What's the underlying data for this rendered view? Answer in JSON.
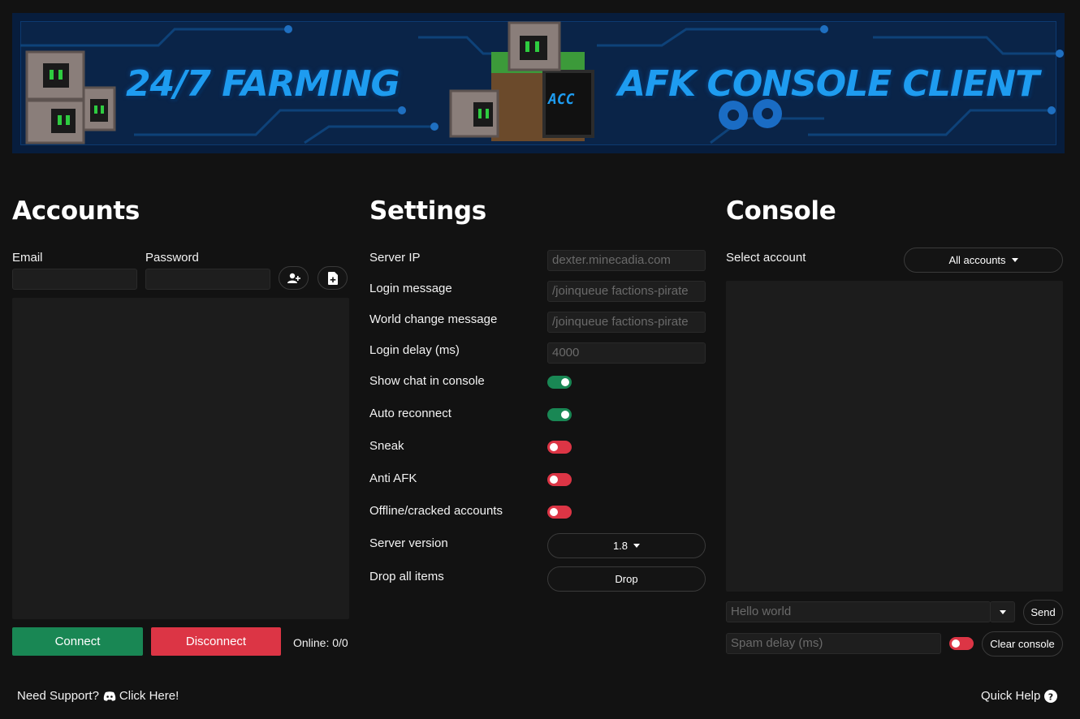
{
  "banner": {
    "left_text": "24/7 FARMING",
    "right_text": "AFK CONSOLE CLIENT",
    "logo_text": "ACC"
  },
  "accounts": {
    "title": "Accounts",
    "email_label": "Email",
    "password_label": "Password",
    "email_value": "",
    "password_value": "",
    "add_account_icon": "user-plus-icon",
    "import_file_icon": "file-plus-icon",
    "connect_label": "Connect",
    "disconnect_label": "Disconnect",
    "online_text": "Online: 0/0"
  },
  "settings": {
    "title": "Settings",
    "server_ip_label": "Server IP",
    "server_ip_placeholder": "dexter.minecadia.com",
    "login_message_label": "Login message",
    "login_message_placeholder": "/joinqueue factions-pirate",
    "world_change_label": "World change message",
    "world_change_placeholder": "/joinqueue factions-pirate",
    "login_delay_label": "Login delay (ms)",
    "login_delay_placeholder": "4000",
    "toggles": [
      {
        "label": "Show chat in console",
        "on": true
      },
      {
        "label": "Auto reconnect",
        "on": true
      },
      {
        "label": "Sneak",
        "on": false
      },
      {
        "label": "Anti AFK",
        "on": false
      },
      {
        "label": "Offline/cracked accounts",
        "on": false
      }
    ],
    "server_version_label": "Server version",
    "server_version_value": "1.8",
    "drop_items_label": "Drop all items",
    "drop_button_label": "Drop"
  },
  "console": {
    "title": "Console",
    "select_account_label": "Select account",
    "select_account_value": "All accounts",
    "message_placeholder": "Hello world",
    "send_label": "Send",
    "spam_delay_placeholder": "Spam delay (ms)",
    "spam_toggle_on": false,
    "clear_label": "Clear console"
  },
  "footer": {
    "support_prefix": "Need Support?",
    "support_link": "Click Here!",
    "support_icon": "discord-icon",
    "quick_help": "Quick Help",
    "help_icon": "question-circle-icon"
  },
  "colors": {
    "background": "#121212",
    "panel": "#1c1c1c",
    "success": "#198754",
    "danger": "#dc3545",
    "banner_blue": "#1e9cf0"
  }
}
